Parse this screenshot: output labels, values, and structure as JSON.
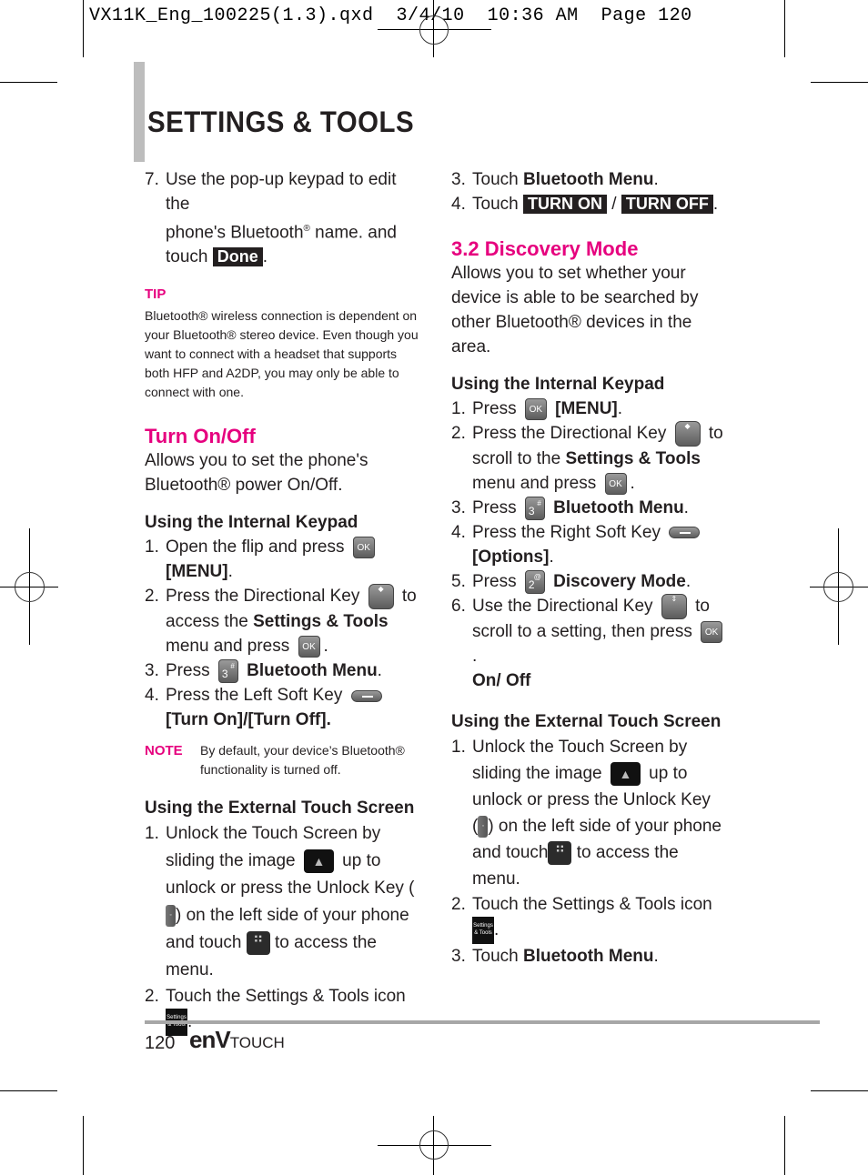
{
  "slug": "VX11K_Eng_100225(1.3).qxd  3/4/10  10:36 AM  Page 120",
  "page_title": "SETTINGS & TOOLS",
  "colors": {
    "accent": "#e6007e",
    "text": "#231f20",
    "rule": "#a7a7a7"
  },
  "left": {
    "step7": {
      "num": "7.",
      "line1": "Use the pop-up keypad to edit the",
      "line2a": "phone's Bluetooth",
      "reg": "®",
      "line2b": " name. and",
      "line3a": "touch",
      "done_label": "Done",
      "line3b": "."
    },
    "tip": {
      "label": "TIP",
      "text": "Bluetooth® wireless connection is dependent on your Bluetooth® stereo device. Even though you want to connect with a headset that supports both HFP and A2DP, you may only be able to connect with one."
    },
    "section_title": "Turn On/Off",
    "intro": "Allows you to set the phone's Bluetooth® power On/Off.",
    "internal_keypad": {
      "heading": "Using the Internal Keypad",
      "steps": [
        {
          "num": "1.",
          "text_a": "Open the flip and press",
          "key": "OK",
          "text_b_bold": "[MENU]",
          "text_c": "."
        },
        {
          "num": "2.",
          "text_a": "Press the Directional Key",
          "text_b": "to access the",
          "bold": "Settings & Tools",
          "text_c": "menu and press",
          "key": "OK",
          "text_d": "."
        },
        {
          "num": "3.",
          "text_a": "Press",
          "key": "3",
          "key_sup": "#",
          "bold": "Bluetooth Menu",
          "text_b": "."
        },
        {
          "num": "4.",
          "text_a": "Press the Left Soft Key",
          "bold": "[Turn On]/[Turn Off]."
        }
      ]
    },
    "note": {
      "label": "NOTE",
      "text": "By default, your device’s Bluetooth® functionality is turned off."
    },
    "external_touch": {
      "heading": "Using the External Touch Screen",
      "steps": [
        {
          "num": "1.",
          "text_a": "Unlock the Touch Screen by sliding the image",
          "text_b": "up to unlock or press the Unlock Key (",
          "text_c": ") on the left side of your phone and touch",
          "text_d": "to access the menu."
        },
        {
          "num": "2.",
          "text_a": "Touch the Settings & Tools icon",
          "text_b": "."
        }
      ]
    }
  },
  "right": {
    "step3": {
      "num": "3.",
      "text_a": "Touch",
      "bold": "Bluetooth Menu",
      "text_b": "."
    },
    "step4": {
      "num": "4.",
      "text_a": "Touch",
      "btn_on": "TURN ON",
      "sep": "/",
      "btn_off": "TURN OFF",
      "text_b": "."
    },
    "section_title": "3.2 Discovery Mode",
    "intro": "Allows you to set whether your device is able to be searched by other Bluetooth® devices in the area.",
    "internal_keypad": {
      "heading": "Using the Internal Keypad",
      "steps": [
        {
          "num": "1.",
          "text_a": "Press",
          "key": "OK",
          "bold": "[MENU]",
          "text_b": "."
        },
        {
          "num": "2.",
          "text_a": "Press the Directional Key",
          "text_b": "to scroll to the",
          "bold": "Settings & Tools",
          "text_c": "menu and press",
          "key": "OK",
          "text_d": "."
        },
        {
          "num": "3.",
          "text_a": "Press",
          "key": "3",
          "key_sup": "#",
          "bold": "Bluetooth Menu",
          "text_b": "."
        },
        {
          "num": "4.",
          "text_a": "Press the Right Soft Key",
          "bold": "[Options]",
          "text_b": "."
        },
        {
          "num": "5.",
          "text_a": "Press",
          "key": "2",
          "key_sup": "@",
          "bold": "Discovery Mode",
          "text_b": "."
        },
        {
          "num": "6.",
          "text_a": "Use the Directional Key",
          "text_b": "to scroll to a setting, then press",
          "key": "OK",
          "text_c": ".",
          "bold": "On/ Off"
        }
      ]
    },
    "external_touch": {
      "heading": "Using the External Touch Screen",
      "steps": [
        {
          "num": "1.",
          "text_a": "Unlock the Touch Screen by sliding the image",
          "text_b": "up to unlock or press the Unlock Key",
          "text_c": "(",
          "text_d": ") on the left side of your phone",
          "text_e": "and touch",
          "text_f": "to access the menu."
        },
        {
          "num": "2.",
          "text_a": "Touch the Settings & Tools icon",
          "text_b": "."
        },
        {
          "num": "3.",
          "text_a": "Touch",
          "bold": "Bluetooth Menu",
          "text_b": "."
        }
      ]
    }
  },
  "footer": {
    "page_number": "120",
    "brand_main": "enV",
    "brand_sub": "TOUCH"
  },
  "icons": {
    "settings_label": "Settings & Tools",
    "unlock_glyph": "▲",
    "menu_glyph": "⠛"
  }
}
